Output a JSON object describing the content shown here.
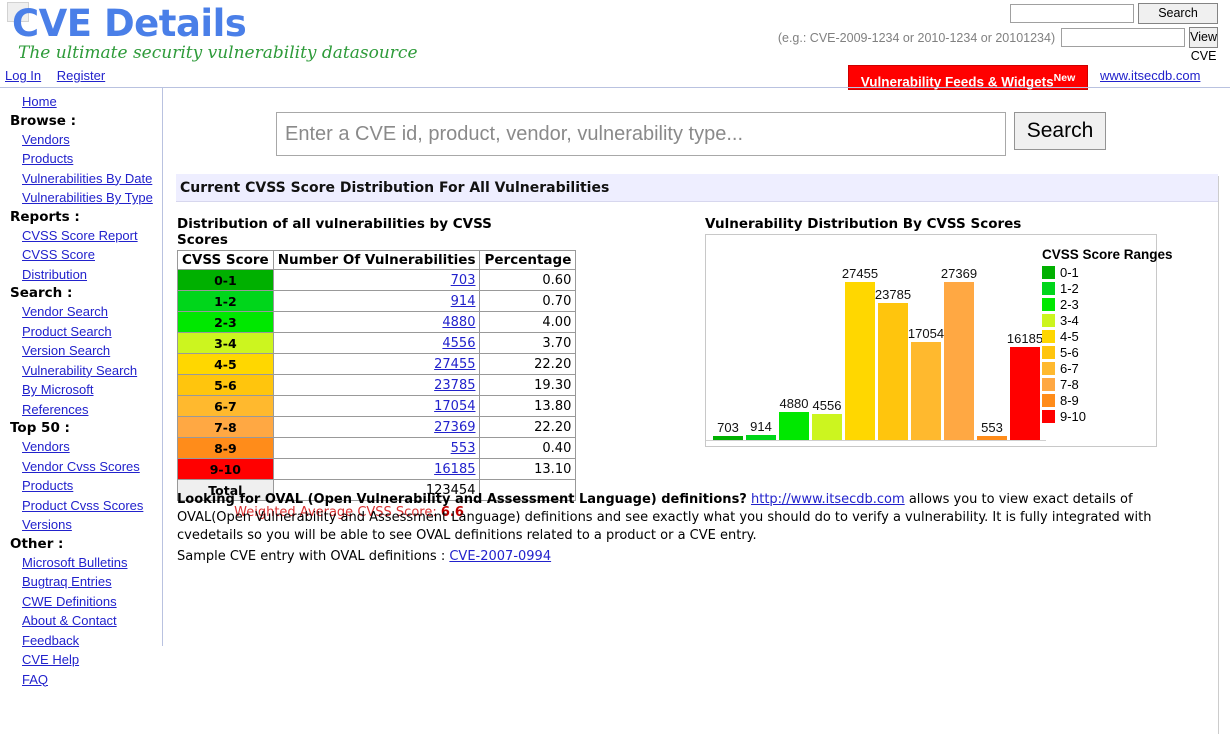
{
  "header": {
    "logo": "CVE Details",
    "tagline": "The ultimate security vulnerability datasource",
    "login_label": "Log In",
    "register_label": "Register",
    "search_value": "",
    "search_button": "Search",
    "cve_hint": "(e.g.: CVE-2009-1234 or 2010-1234 or 20101234)",
    "cve_value": "",
    "view_cve_button": "View CVE",
    "feeds_badge": "Vulnerability Feeds & Widgets",
    "feeds_badge_sup": "New",
    "itsecdb_link": "www.itsecdb.com",
    "brand_color": "#4a7fe8",
    "tagline_color": "#2e9b3a",
    "badge_color": "#ff0000"
  },
  "sidebar": {
    "groups": [
      {
        "heading": "",
        "items": [
          {
            "label": "Home"
          }
        ]
      },
      {
        "heading": "Browse :",
        "items": [
          {
            "label": "Vendors"
          },
          {
            "label": "Products"
          },
          {
            "label": "Vulnerabilities By Date"
          },
          {
            "label": "Vulnerabilities By Type"
          }
        ]
      },
      {
        "heading": "Reports :",
        "items": [
          {
            "label": "CVSS Score Report"
          },
          {
            "label": "CVSS Score"
          },
          {
            "label": "Distribution"
          }
        ]
      },
      {
        "heading": "Search :",
        "items": [
          {
            "label": "Vendor Search"
          },
          {
            "label": "Product Search"
          },
          {
            "label": "Version Search"
          },
          {
            "label": "Vulnerability Search"
          },
          {
            "label": "By Microsoft"
          },
          {
            "label": "References"
          }
        ]
      },
      {
        "heading": "Top 50 :",
        "items": [
          {
            "label": "Vendors"
          },
          {
            "label": "Vendor Cvss Scores"
          },
          {
            "label": "Products"
          },
          {
            "label": "Product Cvss Scores"
          },
          {
            "label": "Versions"
          }
        ]
      },
      {
        "heading": "Other :",
        "items": [
          {
            "label": "Microsoft Bulletins"
          },
          {
            "label": "Bugtraq Entries"
          },
          {
            "label": "CWE Definitions"
          },
          {
            "label": "About & Contact"
          },
          {
            "label": "Feedback"
          },
          {
            "label": "CVE Help"
          },
          {
            "label": "FAQ"
          }
        ]
      }
    ]
  },
  "main": {
    "search_placeholder": "Enter a CVE id, product, vendor, vulnerability type...",
    "search_value": "",
    "search_button": "Search",
    "section_title": "Current CVSS Score Distribution For All Vulnerabilities",
    "table_caption": "Distribution of all vulnerabilities by CVSS Scores",
    "columns": [
      "CVSS Score",
      "Number Of Vulnerabilities",
      "Percentage"
    ],
    "total_label": "Total",
    "total_count": "123454",
    "weighted_prefix": "Weighted Average CVSS Score: ",
    "weighted_value": "6.6"
  },
  "chart_data": {
    "type": "bar",
    "title": "Vulnerability Distribution By CVSS Scores",
    "xlabel": "",
    "ylabel": "",
    "grid": false,
    "legend_position": "right",
    "legend_title": "CVSS Score Ranges",
    "ylim": [
      0,
      27455
    ],
    "categories": [
      "0-1",
      "1-2",
      "2-3",
      "3-4",
      "4-5",
      "5-6",
      "6-7",
      "7-8",
      "8-9",
      "9-10"
    ],
    "values": [
      703,
      914,
      4880,
      4556,
      27455,
      23785,
      17054,
      27369,
      553,
      16185
    ],
    "percentages": [
      "0.60",
      "0.70",
      "4.00",
      "3.70",
      "22.20",
      "19.30",
      "13.80",
      "22.20",
      "0.40",
      "13.10"
    ],
    "colors": [
      "#00b000",
      "#00d61b",
      "#00e800",
      "#ccf51f",
      "#ffd700",
      "#ffc50d",
      "#ffb92e",
      "#ffa843",
      "#ff8c1a",
      "#ff0000"
    ],
    "bar_labels": [
      "703",
      "914",
      "4880",
      "4556",
      "27455",
      "23785",
      "17054",
      "27369",
      "553",
      "16185"
    ]
  },
  "oval": {
    "lead": "Looking for OVAL (Open Vulnerability and Assessment Language) definitions?",
    "link": "http://www.itsecdb.com",
    "body": " allows you to view exact details of OVAL(Open Vulnerability and Assessment Language) definitions and see exactly what you should do to verify a vulnerability. It is fully integrated with cvedetails so you will be able to see OVAL definitions related to a product or a CVE entry.",
    "sample_label": "Sample CVE entry with OVAL definitions : ",
    "sample_link": "CVE-2007-0994"
  }
}
